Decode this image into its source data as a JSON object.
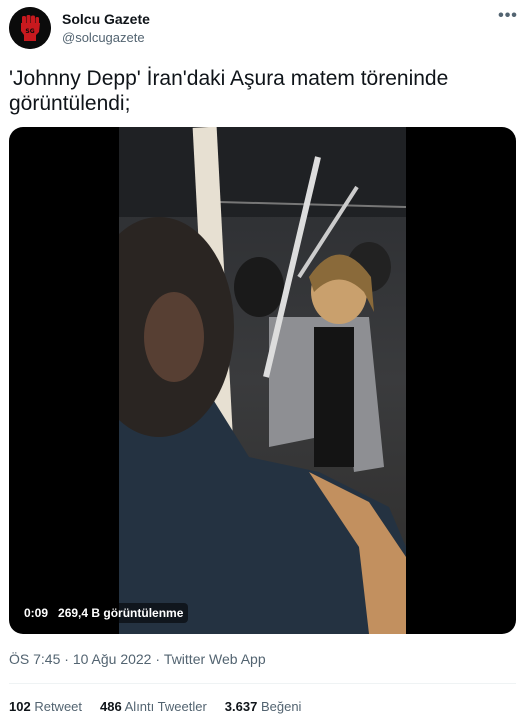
{
  "author": {
    "name": "Solcu Gazete",
    "handle": "@solcugazete",
    "avatar_icon": "red-fist-logo",
    "avatar_text": "SG"
  },
  "more_icon": "•••",
  "tweet": {
    "text": "'Johnny Depp' İran'daki Aşura matem töreninde görüntülendi;"
  },
  "video": {
    "duration": "0:09",
    "views": "269,4 B görüntülenme"
  },
  "meta": {
    "time": "ÖS 7:45",
    "sep1": " · ",
    "date": "10 Ağu 2022",
    "sep2": " · ",
    "source": "Twitter Web App"
  },
  "stats": {
    "retweets_count": "102",
    "retweets_label": "Retweet",
    "quotes_count": "486",
    "quotes_label": "Alıntı Tweetler",
    "likes_count": "3.637",
    "likes_label": "Beğeni"
  },
  "colors": {
    "text_primary": "#0f1419",
    "text_secondary": "#536471",
    "avatar_red": "#c8191e"
  }
}
